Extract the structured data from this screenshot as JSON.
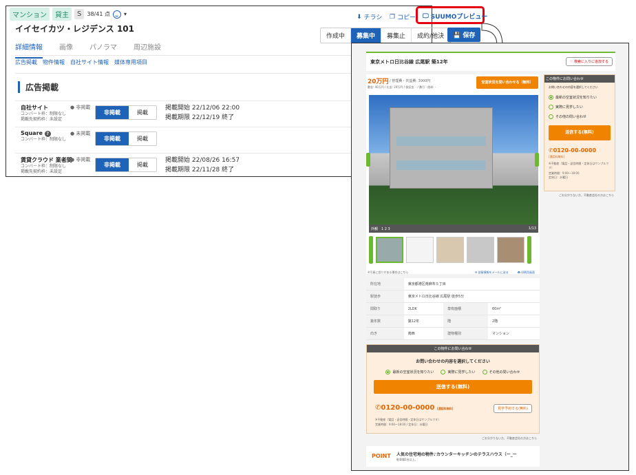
{
  "admin": {
    "tags": [
      "マンション",
      "貸主",
      "S"
    ],
    "score": "38/41 点",
    "toolbar": {
      "flyer": "チラシ",
      "copy": "コピー",
      "preview": "SUUMOプレビュー"
    },
    "title": "イイセイカツ・レジデンス 101",
    "status_seg": [
      "作成中",
      "募集中",
      "募集止",
      "成約/他決"
    ],
    "save": "保存",
    "tabs": [
      "詳細情報",
      "画像",
      "パノラマ",
      "周辺施設"
    ],
    "subnav": [
      "広告掲載",
      "物件情報",
      "自社サイト情報",
      "媒体専用項目"
    ],
    "section": "広告掲載",
    "rows": [
      {
        "name": "自社サイト",
        "sub1": "コンバート枠：制限なし",
        "sub2": "掲載先契約枠：未設定",
        "status": "● 非掲載",
        "off": "非掲載",
        "on": "掲載",
        "d1": "掲載開始 22/12/06 22:00",
        "d2": "掲載期限 22/12/19 終了"
      },
      {
        "name": "Square",
        "sub1": "コンバート枠：制限なし",
        "sub2": "",
        "status": "● 未掲載",
        "off": "非掲載",
        "on": "掲載",
        "d1": "",
        "d2": ""
      },
      {
        "name": "賃貸クラウド 業者間",
        "sub1": "コンバート枠：制限なし",
        "sub2": "掲載先契約枠：未設定",
        "status": "● 非掲載",
        "off": "非掲載",
        "on": "掲載",
        "d1": "掲載開始 22/08/26 16:57",
        "d2": "掲載期限 22/11/28 終了"
      }
    ]
  },
  "suumo": {
    "header": "東京メトロ日比谷線 広尾駅 築12年",
    "fav": "♡ 検索に入りに追加する",
    "price": "20万円",
    "price_sub": "/ 管理費・共益費: 3000円",
    "deposit": "敷金: 40万円 / 礼金: 20万円 / 保証金: - / 敷引・償却: -",
    "vacancy_btn": "空室状況を問い合わせる（無料）",
    "photo_caption": "外観　1 2 3",
    "photo_count": "1/13",
    "photo_note": "※写真に誤りがある場合はこちら",
    "mail": "部屋情報をメールに送る",
    "print": "印刷用画面",
    "props": [
      [
        "所在地",
        "東京都港区南麻布５丁目",
        "",
        ""
      ],
      [
        "駅徒歩",
        "東京メトロ日比谷線 広尾駅 徒歩5分",
        "",
        ""
      ],
      [
        "間取り",
        "2LDK",
        "専有面積",
        "60m²"
      ],
      [
        "築年数",
        "築12年",
        "階",
        "2階"
      ],
      [
        "向き",
        "南西",
        "建物種別",
        "マンション"
      ]
    ],
    "inquiry": {
      "head": "この物件にお問い合わせ",
      "q": "お問い合わせの内容を選択してください",
      "opts": [
        "最新の空室状況を知りたい",
        "実際に見学したい",
        "その他の問い合わせ"
      ],
      "send": "送信する(無料)",
      "phone": "0120-00-0000",
      "free": "[通話料無料]",
      "visit": "見学予約する(無料)",
      "note": "※不動産（電話・返信時間・定休日はサンプルです）",
      "hours": "営業時間：9:00～18:00 / 定休日：水曜日"
    },
    "side": {
      "head": "この物件にお問い合わせ",
      "q": "お問い合わせの内容を選択してください",
      "opts": [
        "最新の空室状況を知りたい",
        "実際に見学したい",
        "その他の問い合わせ"
      ],
      "send": "送信する(無料)",
      "phone": "0120-00-0000",
      "free": "[通話料無料]",
      "note": "※不動産（電話・返信時間・定休日はサンプルです）",
      "hours": "営業時間：9:00～18:00",
      "closed": "定休日：水曜日",
      "report": "ごお分かりない方、不動産会社の方はこちら"
    },
    "point_label": "POINT",
    "point_text": "人気の住宅地の物件♪カウンターキッチンのテラスハウス（ー_ー",
    "point_sub": "駐車場2台以上。",
    "report2": "ごお分かりない方、不動産会社の方はこちら"
  }
}
